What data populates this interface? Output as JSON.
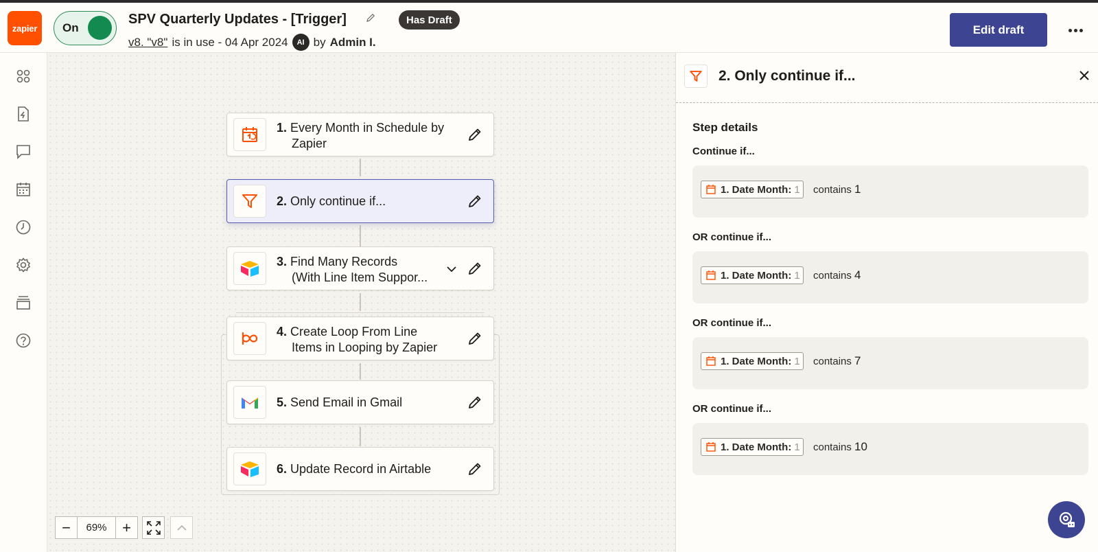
{
  "app": {
    "logo_text": "zapier",
    "toggle_label": "On",
    "title": "SPV Quarterly Updates - [Trigger]",
    "draft_badge": "Has Draft",
    "version_link": "v8. \"v8\"",
    "version_status": "is in use - 04 Apr 2024",
    "ai_badge": "AI",
    "by_label": "by",
    "author": "Admin I.",
    "edit_button": "Edit draft",
    "accent_color": "#3d4592",
    "brand_color": "#ff4f00"
  },
  "sidebar": {
    "icons": [
      "apps-icon",
      "zap-file-icon",
      "chat-icon",
      "calendar-icon",
      "history-icon",
      "settings-icon",
      "layers-icon",
      "help-icon"
    ]
  },
  "steps": [
    {
      "num": "1.",
      "line1": "Every Month in Schedule by",
      "line2": "Zapier",
      "icon": "schedule-icon"
    },
    {
      "num": "2.",
      "line1": "Only continue if...",
      "line2": "",
      "icon": "filter-icon"
    },
    {
      "num": "3.",
      "line1": "Find Many Records",
      "line2": "(With Line Item Suppor...",
      "icon": "airtable-icon"
    },
    {
      "num": "4.",
      "line1": "Create Loop From Line",
      "line2": "Items in Looping by Zapier",
      "icon": "looping-icon"
    },
    {
      "num": "5.",
      "line1": "Send Email in Gmail",
      "line2": "",
      "icon": "gmail-icon"
    },
    {
      "num": "6.",
      "line1": "Update Record in Airtable",
      "line2": "",
      "icon": "airtable-icon"
    }
  ],
  "zoom": {
    "minus": "−",
    "value": "69%",
    "plus": "+"
  },
  "panel": {
    "title": "2. Only continue if...",
    "section_title": "Step details",
    "conditions": [
      {
        "label": "Continue if...",
        "field": "1. Date Month:",
        "field_value": "1",
        "operator": "contains",
        "value": "1"
      },
      {
        "label": "OR continue if...",
        "field": "1. Date Month:",
        "field_value": "1",
        "operator": "contains",
        "value": "4"
      },
      {
        "label": "OR continue if...",
        "field": "1. Date Month:",
        "field_value": "1",
        "operator": "contains",
        "value": "7"
      },
      {
        "label": "OR continue if...",
        "field": "1. Date Month:",
        "field_value": "1",
        "operator": "contains",
        "value": "10"
      }
    ]
  }
}
